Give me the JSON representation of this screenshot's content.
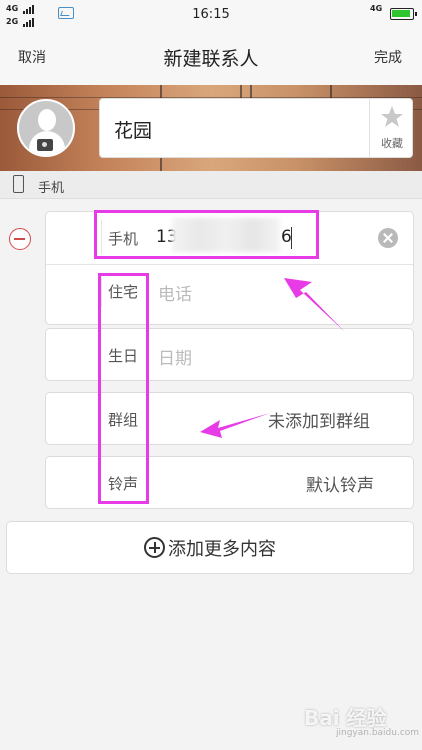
{
  "status_bar": {
    "sig1": "4G",
    "sig2": "2G",
    "time": "16:15",
    "net": "4G"
  },
  "nav": {
    "cancel_label": "取消",
    "title": "新建联系人",
    "done_label": "完成"
  },
  "contact": {
    "name": "花园",
    "favorite_label": "收藏"
  },
  "section": {
    "label": "手机"
  },
  "fields": {
    "mobile": {
      "label": "手机",
      "value_prefix": "13",
      "value_suffix": "6"
    },
    "home": {
      "label": "住宅",
      "placeholder": "电话"
    },
    "birthday": {
      "label": "生日",
      "placeholder": "日期"
    },
    "group": {
      "label": "群组",
      "value": "未添加到群组"
    },
    "ringtone": {
      "label": "铃声",
      "value": "默认铃声"
    }
  },
  "add_more": {
    "label": "添加更多内容"
  },
  "watermark": {
    "brand": "Bai 经验",
    "url": "jingyan.baidu.com"
  },
  "colors": {
    "highlight": "#e63be6",
    "minus": "#d24b4b",
    "battery": "#2ec52e"
  },
  "icons": [
    "image-icon",
    "battery-icon",
    "camera-icon",
    "star-icon",
    "phone-icon",
    "minus-circle-icon",
    "clear-icon",
    "plus-circle-icon"
  ]
}
